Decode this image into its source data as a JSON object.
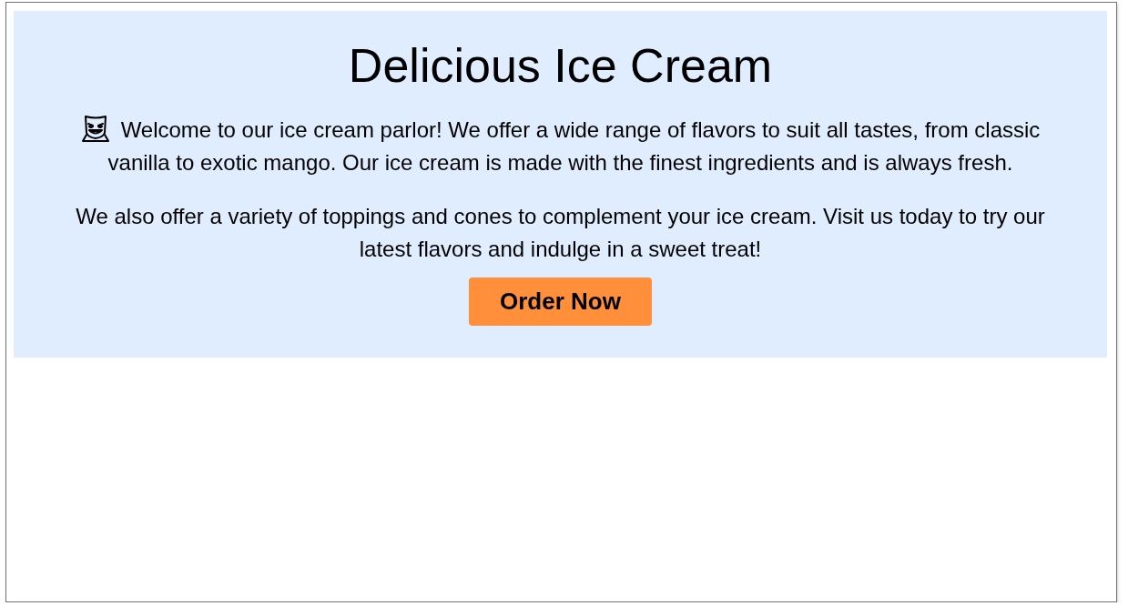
{
  "hero": {
    "title": "Delicious Ice Cream",
    "paragraphs": [
      "Welcome to our ice cream parlor! We offer a wide range of flavors to suit all tastes, from classic vanilla to exotic mango. Our ice cream is made with the finest ingredients and is always fresh.",
      "We also offer a variety of toppings and cones to complement your ice cream. Visit us today to try our latest flavors and indulge in a sweet treat!"
    ],
    "button": "Order Now"
  }
}
